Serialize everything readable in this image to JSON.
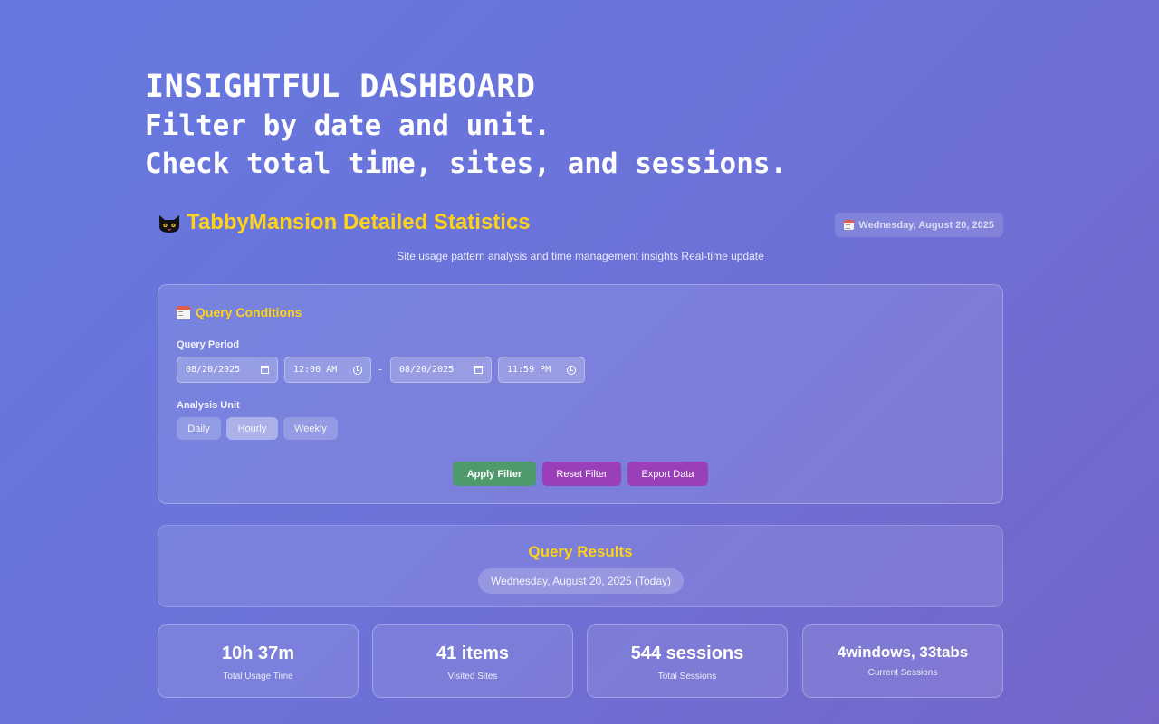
{
  "hero": {
    "title": "INSIGHTFUL DASHBOARD",
    "line1": "Filter by date and unit.",
    "line2": "Check total time, sites, and sessions."
  },
  "header": {
    "app_title": "TabbyMansion Detailed Statistics",
    "date": "Wednesday, August 20, 2025",
    "subtitle": "Site usage pattern analysis and time management insights Real-time update"
  },
  "query": {
    "heading": "Query Conditions",
    "period_label": "Query Period",
    "start_date": "08/20/2025",
    "start_time": "12:00 AM",
    "range_separator": "-",
    "end_date": "08/20/2025",
    "end_time": "11:59 PM",
    "unit_label": "Analysis Unit",
    "units": [
      "Daily",
      "Hourly",
      "Weekly"
    ],
    "selected_unit": "Hourly",
    "apply_label": "Apply Filter",
    "reset_label": "Reset Filter",
    "export_label": "Export Data"
  },
  "results": {
    "title": "Query Results",
    "date_label": "Wednesday, August 20, 2025 (Today)"
  },
  "stats": [
    {
      "value": "10h 37m",
      "label": "Total Usage Time"
    },
    {
      "value": "41 items",
      "label": "Visited Sites"
    },
    {
      "value": "544 sessions",
      "label": "Total Sessions"
    },
    {
      "value": "4windows, 33tabs",
      "label": "Current Sessions"
    }
  ],
  "colors": {
    "accent_yellow": "#ffd21a",
    "apply_green": "#4f9a6c",
    "action_purple": "#9a3fb8",
    "background_start": "#6579e0",
    "background_end": "#7466c9"
  },
  "icons": {
    "app_logo": "black-cat-icon",
    "date_chip": "calendar-icon",
    "query_heading": "calendar-icon"
  }
}
